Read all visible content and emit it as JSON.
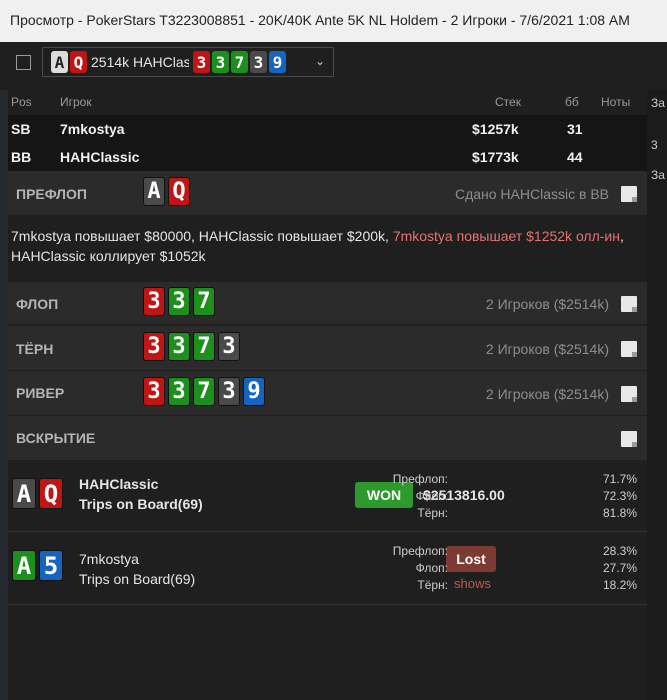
{
  "window": {
    "title": "Просмотр - PokerStars T3223008851 - 20K/40K Ante 5K NL Holdem - 2 Игроки - 7/6/2021 1:08 AM"
  },
  "hand_selector": {
    "hole_cards": [
      {
        "rank": "A",
        "suit": "s"
      },
      {
        "rank": "Q",
        "suit": "h"
      }
    ],
    "text": "2514k HAHClas",
    "board_cards": [
      {
        "rank": "3",
        "suit": "h"
      },
      {
        "rank": "3",
        "suit": "c"
      },
      {
        "rank": "7",
        "suit": "c"
      },
      {
        "rank": "3",
        "suit": "s"
      },
      {
        "rank": "9",
        "suit": "d"
      }
    ]
  },
  "table_header": {
    "pos": "Pos",
    "player": "Игрок",
    "stack": "Стек",
    "bb": "бб",
    "notes": "Ноты"
  },
  "players": [
    {
      "pos": "SB",
      "name": "7mkostya",
      "stack": "$1257k",
      "bb": "31"
    },
    {
      "pos": "BB",
      "name": "HAHClassic",
      "stack": "$1773k",
      "bb": "44"
    }
  ],
  "preflop": {
    "title": "ПРЕФЛОП",
    "cards": [
      {
        "rank": "A",
        "suit": "s"
      },
      {
        "rank": "Q",
        "suit": "h"
      }
    ],
    "info": "Сдано HAHClassic в BB",
    "actions_normal": "7mkostya повышает $80000, HAHClassic повышает $200k, ",
    "actions_allin": "7mkostya повышает $1252k олл-ин",
    "actions_tail": ", HAHClassic коллирует $1052k"
  },
  "flop": {
    "title": "ФЛОП",
    "cards": [
      {
        "rank": "3",
        "suit": "h"
      },
      {
        "rank": "3",
        "suit": "c"
      },
      {
        "rank": "7",
        "suit": "c"
      }
    ],
    "info": "2 Игроков ($2514k)"
  },
  "turn": {
    "title": "ТЁРН",
    "cards": [
      {
        "rank": "3",
        "suit": "h"
      },
      {
        "rank": "3",
        "suit": "c"
      },
      {
        "rank": "7",
        "suit": "c"
      },
      {
        "rank": "3",
        "suit": "s"
      }
    ],
    "info": "2 Игроков ($2514k)"
  },
  "river": {
    "title": "РИВЕР",
    "cards": [
      {
        "rank": "3",
        "suit": "h"
      },
      {
        "rank": "3",
        "suit": "c"
      },
      {
        "rank": "7",
        "suit": "c"
      },
      {
        "rank": "3",
        "suit": "s"
      },
      {
        "rank": "9",
        "suit": "d"
      }
    ],
    "info": "2 Игроков ($2514k)"
  },
  "showdown": {
    "title": "ВСКРЫТИЕ"
  },
  "results": [
    {
      "cards": [
        {
          "rank": "A",
          "suit": "s"
        },
        {
          "rank": "Q",
          "suit": "h"
        }
      ],
      "name": "HAHClassic",
      "desc": "Trips on Board(69)",
      "badge": "WON",
      "amount": "$2513816.00",
      "equity": [
        {
          "label": "Префлоп:",
          "value": "71.7%"
        },
        {
          "label": "Флоп:",
          "value": "72.3%"
        },
        {
          "label": "Тёрн:",
          "value": "81.8%"
        }
      ]
    },
    {
      "cards": [
        {
          "rank": "A",
          "suit": "c"
        },
        {
          "rank": "5",
          "suit": "d"
        }
      ],
      "name": "7mkostya",
      "desc": "Trips on Board(69)",
      "badge": "Lost",
      "shows": "shows",
      "equity": [
        {
          "label": "Префлоп:",
          "value": "28.3%"
        },
        {
          "label": "Флоп:",
          "value": "27.7%"
        },
        {
          "label": "Тёрн:",
          "value": "18.2%"
        }
      ]
    }
  ],
  "right_pane": {
    "tab": "За",
    "value": "3",
    "label": "За"
  },
  "colors": {
    "spade": "#4a4a4a",
    "heart": "#c01515",
    "club": "#1c8f1c",
    "diamond": "#1565c0",
    "won": "#2e9a2e",
    "lost": "#7d3a33"
  }
}
